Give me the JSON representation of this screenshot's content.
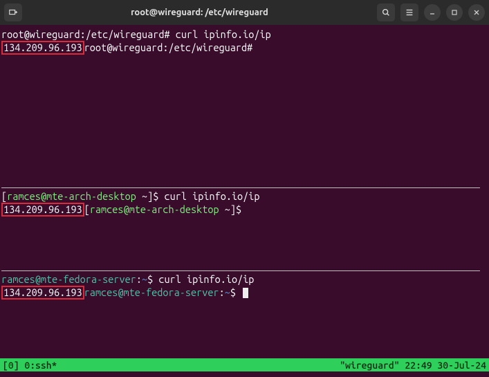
{
  "titlebar": {
    "title": "root@wireguard: /etc/wireguard"
  },
  "pane1": {
    "prompt1": "root@wireguard:/etc/wireguard# ",
    "cmd1": "curl ipinfo.io/ip",
    "ip": "134.209.96.193",
    "prompt2": "root@wireguard:/etc/wireguard# "
  },
  "pane2": {
    "prompt1_open": "[",
    "prompt1_user": "ramces@mte-arch-desktop",
    "prompt1_close": " ~]$ ",
    "cmd1": "curl ipinfo.io/ip",
    "ip": "134.209.96.193",
    "prompt2_open": "[",
    "prompt2_user": "ramces@mte-arch-desktop",
    "prompt2_close": " ~]$"
  },
  "pane3": {
    "user": "ramces@mte-fedora-server",
    "sep": ":",
    "path": "~",
    "dollar": "$ ",
    "cmd": "curl ipinfo.io/ip",
    "ip": "134.209.96.193"
  },
  "statusbar": {
    "left": "[0] 0:ssh*",
    "right": "\"wireguard\" 22:49 30-Jul-24"
  }
}
